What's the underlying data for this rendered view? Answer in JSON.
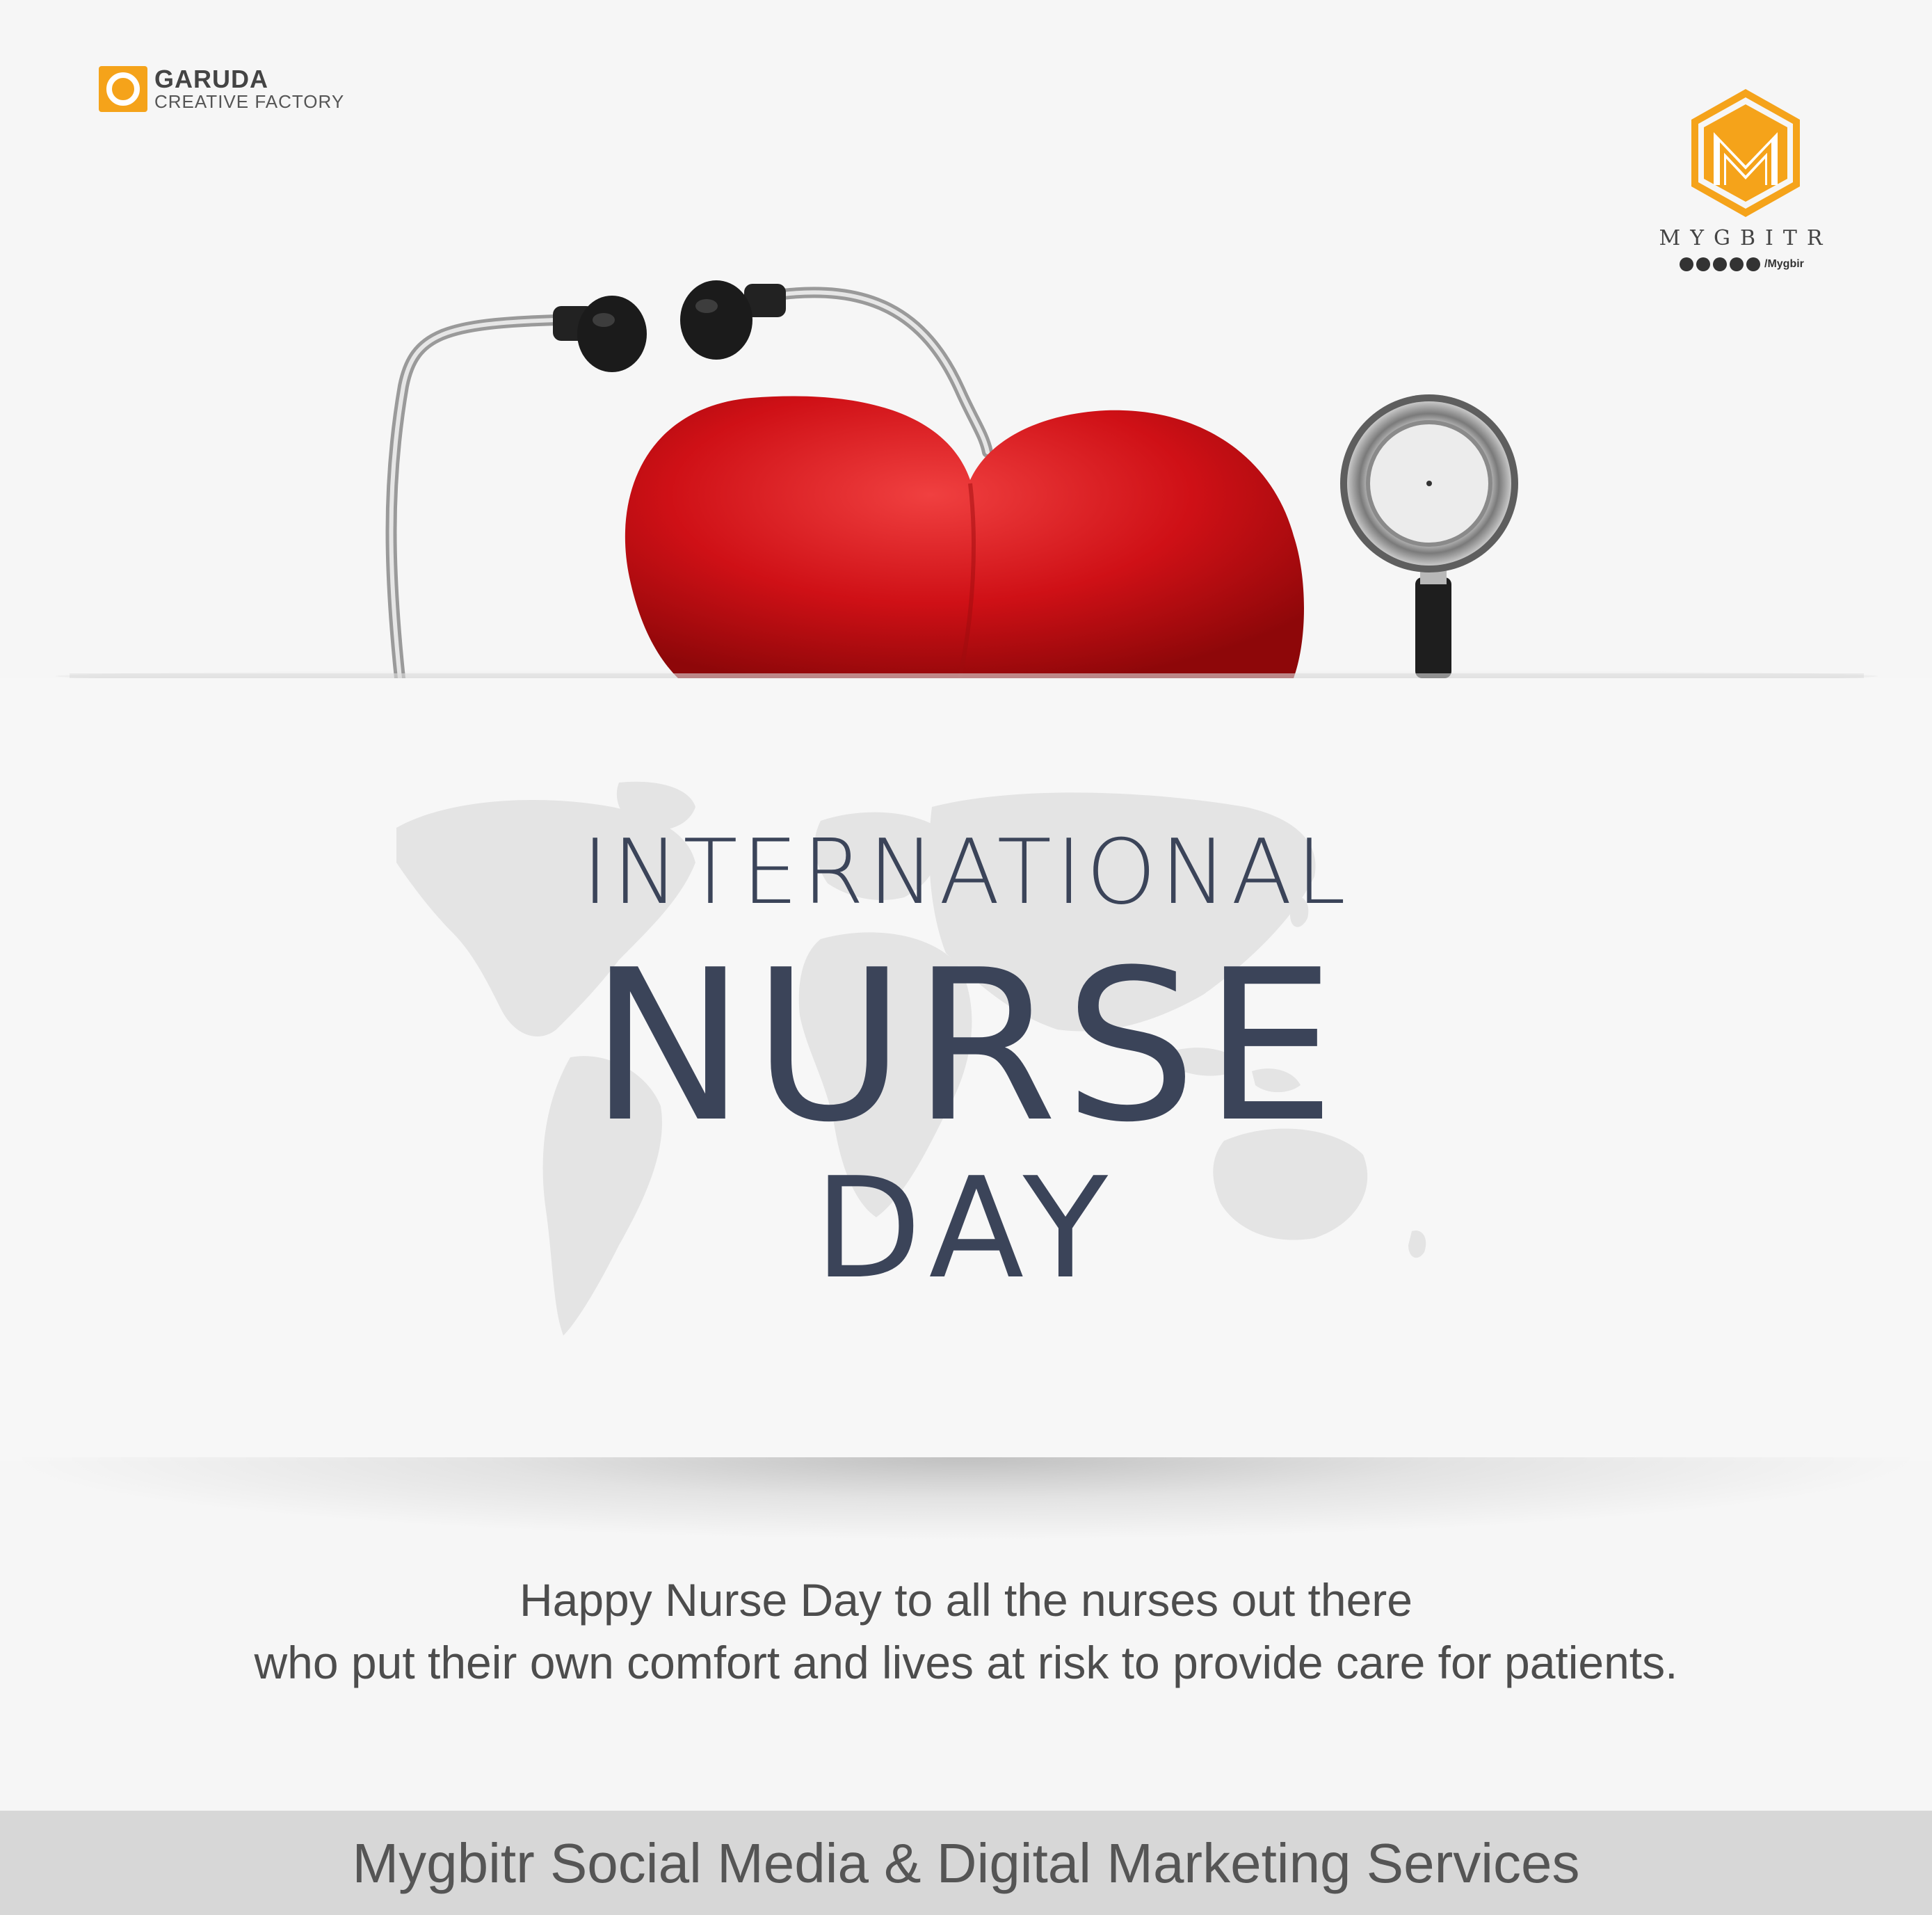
{
  "brand_left": {
    "name": "GARUDA",
    "subtitle": "CREATIVE FACTORY"
  },
  "brand_right": {
    "name": "MYGBITR",
    "handle": "/Mygbir",
    "social_icons": [
      "facebook-icon",
      "instagram-icon",
      "twitter-icon",
      "telegram-icon",
      "youtube-icon"
    ]
  },
  "headline": {
    "line1": "INTERNATIONAL",
    "line2": "NURSE",
    "line3": "DAY"
  },
  "message": {
    "line1": "Happy Nurse Day to all the nurses out there",
    "line2": "who put their own comfort and lives at risk to provide care for patients."
  },
  "footer": {
    "text": "Mygbitr Social Media & Digital Marketing Services"
  },
  "colors": {
    "background": "#f6f6f6",
    "accent_orange": "#f5a31a",
    "heart_red": "#d0141a",
    "title_navy": "#3b4459",
    "footer_bar": "#d7d7d7"
  }
}
